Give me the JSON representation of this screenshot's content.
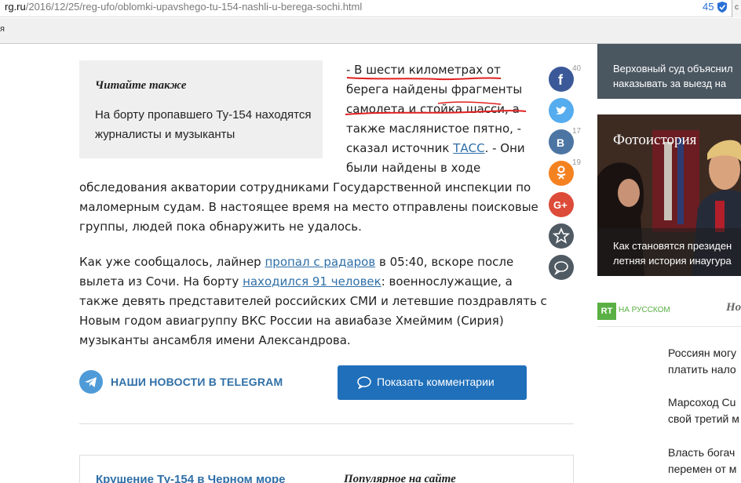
{
  "browser": {
    "url_host": "rg.ru",
    "url_path": "/2016/12/25/reg-ufo/oblomki-upavshego-tu-154-nashli-u-berega-sochi.html",
    "counter": "45",
    "bookmarks_text": "я"
  },
  "read_also": {
    "title": "Читайте также",
    "link": "На борту пропавшего Ту-154 находятся журналисты и музыканты"
  },
  "article": {
    "p1_a": "- В шести километрах от берега найдены фрагменты самолета и стойка шасси, а также маслянистое пятно, - сказал источник ",
    "p1_link": "ТАСС",
    "p1_b": ". - Они были найдены в ходе",
    "p1_cont": "обследования акватории сотрудниками Государственной инспекции по маломерным судам. В настоящее время на место отправлены поисковые группы, людей пока обнаружить не удалось.",
    "p2_a": "Как уже сообщалось, лайнер ",
    "p2_link1": "пропал с радаров",
    "p2_b": " в 05:40, вскоре после вылета из Сочи. На борту ",
    "p2_link2": "находился 91 человек",
    "p2_c": ": военнослужащие, а также девять представителей российских СМИ и летевшие поздравлять с Новым годом авиагруппу ВКС России на авиабазе Хмеймим (Сирия) музыканты ансамбля имени Александрова."
  },
  "share": {
    "facebook_count": "40",
    "twitter_count": "",
    "vk_count": "17",
    "ok_count": "19",
    "colors": {
      "facebook": "#3b5998",
      "twitter": "#55acee",
      "vk": "#4c75a3",
      "ok": "#f58220",
      "gplus": "#dd4b39",
      "favorite": "#4f5a63",
      "comment": "#4f5a63"
    },
    "icons": [
      "facebook-icon",
      "twitter-icon",
      "vk-icon",
      "odnoklassniki-icon",
      "google-plus-icon",
      "star-icon",
      "comment-icon"
    ]
  },
  "telegram": {
    "label": "НАШИ НОВОСТИ В TELEGRAM"
  },
  "comments_button": {
    "label": "Показать комментарии"
  },
  "bottom": {
    "left_title": "Крушение Ту-154 в Черном море",
    "right_title": "Популярное на сайте"
  },
  "sidebar": {
    "card1_line1": "Верховный суд объяснил",
    "card1_line2": "наказывать за выезд на",
    "photo_title": "Фотоистория",
    "photo_cap1": "Как становятся президен",
    "photo_cap2": "летняя история инаугура",
    "rt_logo": "RT",
    "rt_label": "НА РУССКОМ",
    "section_head": "Но",
    "news": [
      {
        "l1": "Россиян могу",
        "l2": "платить нало"
      },
      {
        "l1": "Марсоход Cu",
        "l2": "свой третий м"
      },
      {
        "l1": "Власть богач",
        "l2": "перемен от м"
      }
    ]
  },
  "accent": "#1f6fba",
  "annotation_color": "#e02020"
}
